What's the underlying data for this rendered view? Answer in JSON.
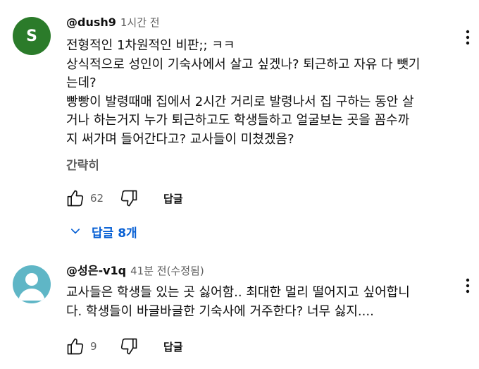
{
  "comments": [
    {
      "author": "@dush9",
      "time": "1시간 전",
      "avatar_letter": "S",
      "avatar_color": "#2b7b2a",
      "lines": [
        "전형적인 1차원적인 비판;; ㅋㅋ",
        "상식적으로 성인이 기숙사에서 살고 싶겠나? 퇴근하고 자유 다 뺏기",
        "는데?",
        "빵빵이 발령때매 집에서 2시간 거리로 발령나서 집 구하는 동안 살",
        "거나 하는거지 누가 퇴근하고도 학생들하고 얼굴보는 곳을 꼼수까",
        "지 써가며 들어간다고? 교사들이 미쳤겠음?"
      ],
      "show_less": "간략히",
      "likes": "62",
      "reply_label": "답글",
      "replies_toggle": "답글 8개"
    },
    {
      "author": "@성은-v1q",
      "time": "41분 전(수정됨)",
      "avatar_color": "#5fb6c6",
      "lines": [
        "교사들은 학생들 있는 곳 싫어함.. 최대한 멀리 떨어지고 싶어합니",
        "다. 학생들이 바글바글한 기숙사에 거주한다? 너무 싫지...."
      ],
      "likes": "9",
      "reply_label": "답글"
    }
  ],
  "colors": {
    "link_blue": "#065fd4",
    "secondary_text": "#606060"
  },
  "icons": [
    "thumbs-up-icon",
    "thumbs-down-icon",
    "more-vert-icon",
    "chevron-down-icon"
  ]
}
